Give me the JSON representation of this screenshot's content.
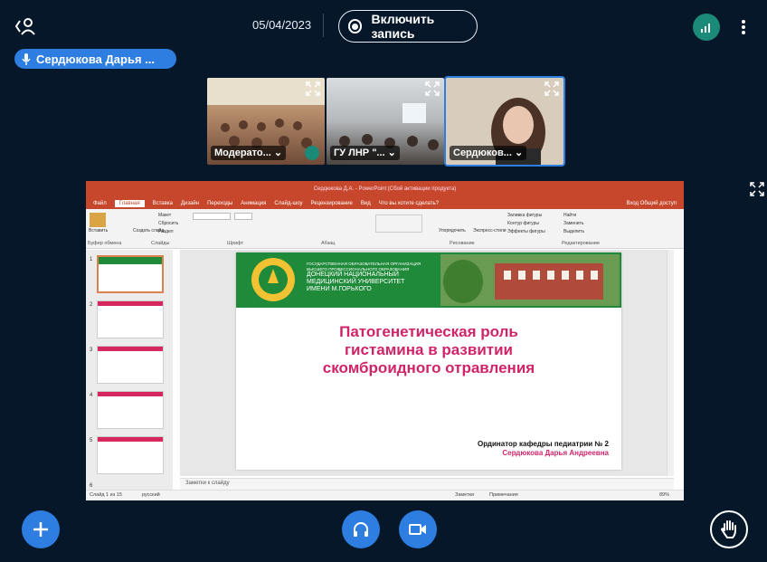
{
  "topbar": {
    "date": "05/04/2023",
    "record_label": "Включить запись"
  },
  "user_chip": {
    "name": "Сердюкова Дарья ..."
  },
  "tiles": [
    {
      "name": "Модерато..."
    },
    {
      "name": "ГУ ЛНР \"..."
    },
    {
      "name": "Сердюков..."
    }
  ],
  "ppt": {
    "window_title": "Сердюкова Д.А. - PowerPoint (Сбой активации продукта)",
    "tabs": [
      "Файл",
      "Главная",
      "Вставка",
      "Дизайн",
      "Переходы",
      "Анимация",
      "Слайд-шоу",
      "Рецензирование",
      "Вид",
      "Что вы хотите сделать?"
    ],
    "active_tab": "Главная",
    "right_tabs": "Вход   Общий доступ",
    "groups": [
      "Буфер обмена",
      "Слайды",
      "Шрифт",
      "Абзац",
      "Рисование",
      "Редактирование"
    ],
    "ribbon": {
      "paste": "Вставить",
      "create": "Создать слайд",
      "layout": "Макет",
      "reset": "Сбросить",
      "section": "Раздел",
      "arrange": "Упорядочить",
      "styles": "Экспресс-стили",
      "fill": "Заливка фигуры",
      "outline": "Контур фигуры",
      "effects": "Эффекты фигуры",
      "find": "Найти",
      "replace": "Заменить",
      "select": "Выделить"
    },
    "thumbs": [
      "1",
      "2",
      "3",
      "4",
      "5",
      "6"
    ],
    "slide": {
      "banner_small": "ГОСУДАРСТВЕННАЯ ОБРАЗОВАТЕЛЬНАЯ ОРГАНИЗАЦИЯ ВЫСШЕГО ПРОФЕССИОНАЛЬНОГО ОБРАЗОВАНИЯ",
      "banner_big": "ДОНЕЦКИЙ НАЦИОНАЛЬНЫЙ МЕДИЦИНСКИЙ УНИВЕРСИТЕТ ИМЕНИ М.ГОРЬКОГО",
      "title_line1": "Патогенетическая роль",
      "title_line2": "гистамина в развитии",
      "title_line3": "скомброидного отравления",
      "author_role": "Ординатор кафедры педиатрии № 2",
      "author_name": "Сердюкова Дарья Андреевна"
    },
    "notes_placeholder": "Заметки к слайду",
    "status": {
      "slide": "Слайд 1 из 15",
      "lang": "русский",
      "notes": "Заметки",
      "comments": "Примечания",
      "zoom": "89%"
    }
  },
  "colors": {
    "bg": "#06172a",
    "accent": "#2d7ee0",
    "ppt": "#c6472b",
    "slide_title": "#d0246a",
    "banner": "#1f8a3a"
  }
}
